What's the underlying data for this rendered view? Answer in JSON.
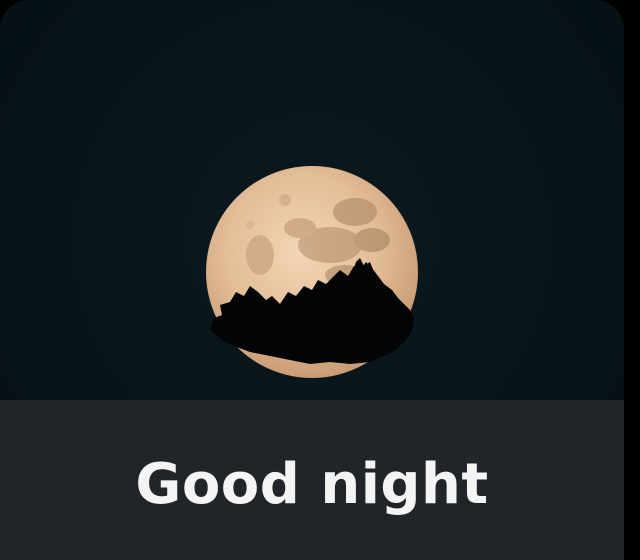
{
  "caption": {
    "text": "Good night"
  },
  "photo": {
    "subject": "full-moon-over-trees",
    "colors": {
      "sky": "#081419",
      "moon": "#e8c7a4",
      "moon_shadow": "#b88f6b",
      "trees": "#020405"
    }
  },
  "caption_bar": {
    "color": "#212529",
    "text_color": "#f4f4f4"
  }
}
